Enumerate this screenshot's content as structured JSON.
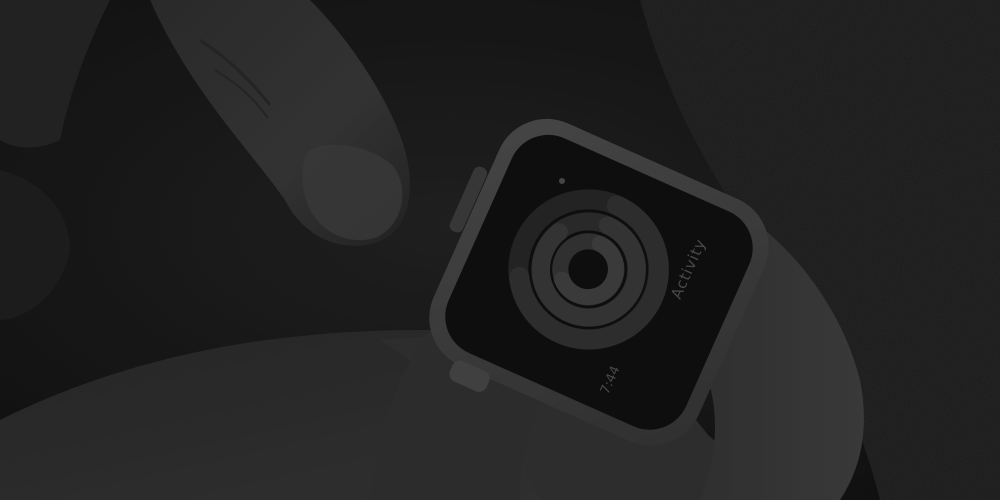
{
  "photo": {
    "subject": "smartwatch-on-wrist",
    "tone": "monochrome-dark",
    "colors": {
      "background": "#1a1a1a",
      "sleeve": "#212121",
      "skin": "#3a3a3a",
      "watch_body": "#4a4a4a",
      "watch_screen": "#121212",
      "band": "#404040"
    }
  },
  "watch": {
    "app_label": "Activity",
    "time": "7:44"
  }
}
